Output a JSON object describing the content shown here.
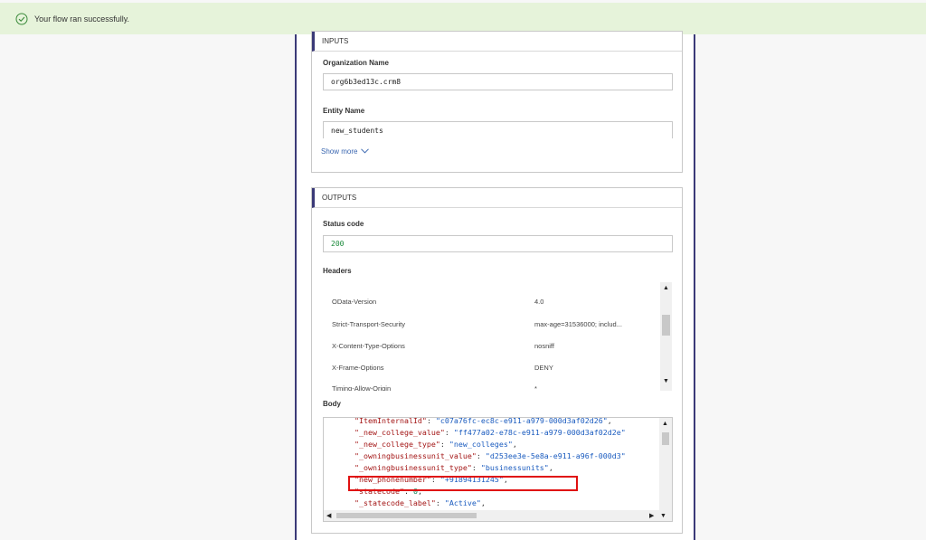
{
  "banner": {
    "message": "Your flow ran successfully."
  },
  "inputs": {
    "title": "INPUTS",
    "org_label": "Organization Name",
    "org_value": "org6b3ed13c.crm8",
    "entity_label": "Entity Name",
    "entity_value": "new_students",
    "show_more": "Show more"
  },
  "outputs": {
    "title": "OUTPUTS",
    "status_label": "Status code",
    "status_value": "200",
    "headers_label": "Headers",
    "headers": [
      {
        "key": "OData-Version",
        "value": "4.0"
      },
      {
        "key": "Strict-Transport-Security",
        "value": "max-age=31536000; includ..."
      },
      {
        "key": "X-Content-Type-Options",
        "value": "nosniff"
      },
      {
        "key": "X-Frame-Options",
        "value": "DENY"
      },
      {
        "key": "Timing-Allow-Origin",
        "value": "*"
      }
    ],
    "body_label": "Body",
    "body_lines": [
      {
        "k": "\"ItemInternalId\"",
        "v": "\"c07a76fc-ec8c-e911-a979-000d3af02d26\"",
        "t": ","
      },
      {
        "k": "\"_new_college_value\"",
        "v": "\"ff477a02-e78c-e911-a979-000d3af02d2e\"",
        "t": ""
      },
      {
        "k": "\"_new_college_type\"",
        "v": "\"new_colleges\"",
        "t": ","
      },
      {
        "k": "\"_owningbusinessunit_value\"",
        "v": "\"d253ee3e-5e8a-e911-a96f-000d3\"",
        "t": ""
      },
      {
        "k": "\"_owningbusinessunit_type\"",
        "v": "\"businessunits\"",
        "t": ","
      },
      {
        "k": "\"new_phonenumber\"",
        "v": "\"+91894131245\"",
        "t": ","
      },
      {
        "k": "\"statecode\"",
        "v": "0",
        "t": ","
      },
      {
        "k": "\"_statecode_label\"",
        "v": "\"Active\"",
        "t": ","
      }
    ]
  },
  "colors": {
    "banner_bg": "#e6f3da",
    "accent": "#3b3a78",
    "highlight": "#e01010"
  },
  "icons": {
    "banner": "check-circle-icon",
    "show_more": "chevron-down-icon"
  }
}
